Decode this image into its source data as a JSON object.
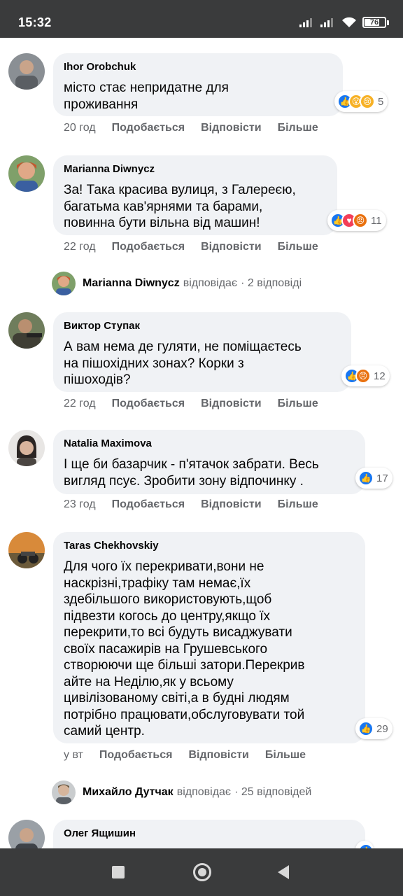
{
  "status_bar": {
    "time": "15:32",
    "battery": "76",
    "battery_level": 0.76
  },
  "comments": [
    {
      "author": "Ihor Orobchuk",
      "text": "місто стає непридатне для\nпроживання",
      "time": "20 год",
      "like": "Подобається",
      "reply": "Відповісти",
      "more": "Більше",
      "reactions": [
        "like",
        "wow",
        "sad"
      ],
      "reaction_count": "5",
      "avatar_color": "#8a8f94"
    },
    {
      "author": "Marianna Diwnycz",
      "text": "За! Така красива вулиця, з Галереєю,\nбагатьма кав'ярнями та барами,\nповинна бути вільна від машин!",
      "time": "22 год",
      "like": "Подобається",
      "reply": "Відповісти",
      "more": "Більше",
      "reactions": [
        "like",
        "love",
        "angry"
      ],
      "reaction_count": "11",
      "avatar_color": "#c8552e"
    },
    {
      "author": "Виктор Ступак",
      "text": "А вам нема де гуляти, не поміщаєтесь\nна пішохідних зонах? Корки з\nпішоходів?",
      "time": "22 год",
      "like": "Подобається",
      "reply": "Відповісти",
      "more": "Більше",
      "reactions": [
        "like",
        "angry"
      ],
      "reaction_count": "12",
      "avatar_color": "#5b5a4c"
    },
    {
      "author": "Natalia Maximova",
      "text": "І ще би базарчик - п'ятачок забрати. Весь\nвигляд псує. Зробити зону відпочинку .",
      "time": "23 год",
      "like": "Подобається",
      "reply": "Відповісти",
      "more": "Більше",
      "reactions": [
        "like"
      ],
      "reaction_count": "17",
      "avatar_color": "#6a6460"
    },
    {
      "author": "Taras Chekhovskiy",
      "text": "Для чого їх перекривати,вони не\nнаскрізні,трафіку там немає,їх\nздебільшого використовують,щоб\nпідвезти когось до центру,якщо їх\nперекрити,то всі будуть висаджувати\nсвоїх пасажирів на Грушевського\nстворюючи ще більші затори.Перекрив\nайте на Неділю,як у всьому\nцивілізованому світі,а в будні людям\nпотрібно працювати,обслуговувати той\nсамий центр.",
      "time": "у вт",
      "like": "Подобається",
      "reply": "Відповісти",
      "more": "Більше",
      "reactions": [
        "like"
      ],
      "reaction_count": "29",
      "avatar_color": "#b06a2c"
    },
    {
      "author": "Олег Ящишин",
      "text": "",
      "avatar_color": "#7d8288"
    }
  ],
  "replies": [
    {
      "name": "Marianna Diwnycz",
      "verb": "відповідає",
      "count": "· 2 відповіді",
      "avatar_color": "#c8552e"
    },
    {
      "name": "Михайло Дутчак",
      "verb": "відповідає",
      "count": "· 25 відповідей",
      "avatar_color": "#8b8f92"
    }
  ]
}
